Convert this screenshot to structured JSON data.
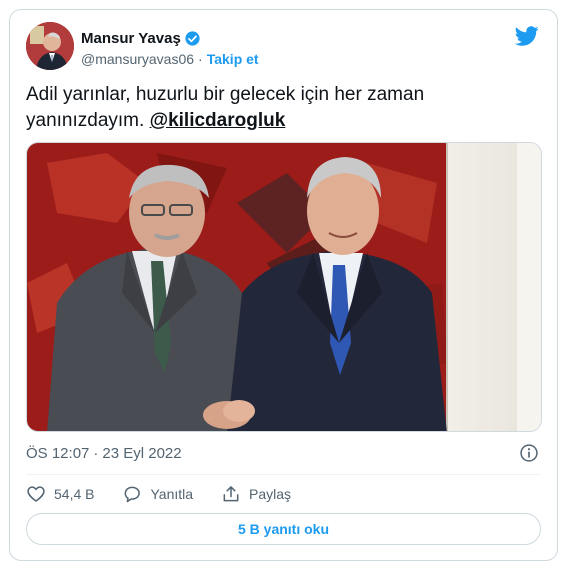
{
  "author": {
    "display_name": "Mansur Yavaş",
    "handle": "@mansuryavas06",
    "separator": "·",
    "follow_label": "Takip et"
  },
  "tweet": {
    "text": "Adil yarınlar, huzurlu bir gelecek için her zaman yanınızdayım.",
    "mention": "@kilicdarogluk"
  },
  "meta": {
    "time": "ÖS 12:07",
    "separator": "·",
    "date": "23 Eyl 2022"
  },
  "actions": {
    "likes_count": "54,4 B",
    "reply_label": "Yanıtla",
    "share_label": "Paylaş"
  },
  "replies_button": "5 B yanıtı oku",
  "colors": {
    "brand_blue": "#1d9bf0",
    "text_primary": "#0f1419",
    "text_secondary": "#536471",
    "border": "#cfd9de"
  }
}
